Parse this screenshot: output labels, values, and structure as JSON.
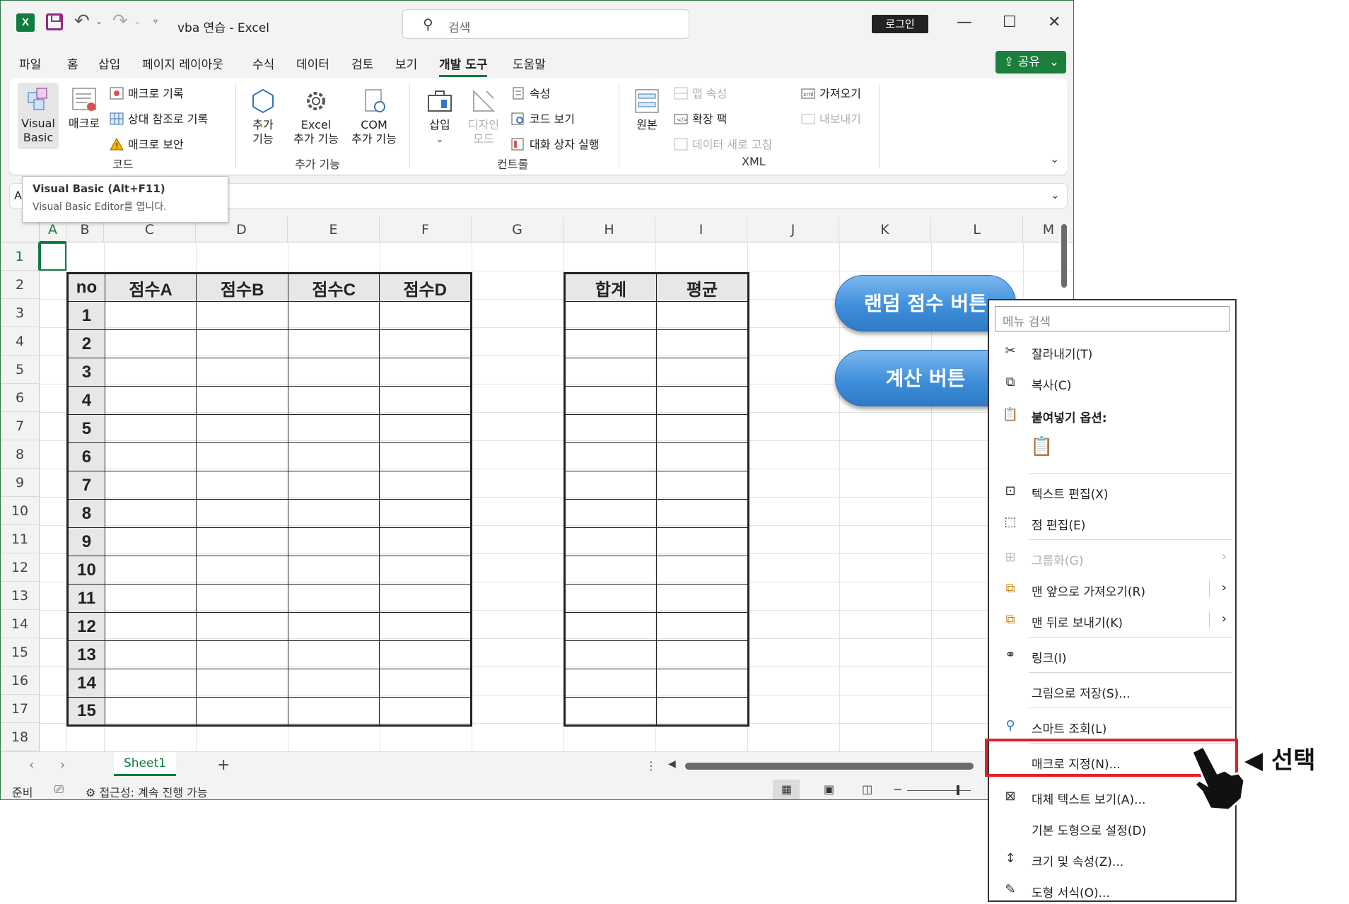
{
  "titlebar": {
    "app_logo": "X",
    "doc_title": "vba 연습  -  Excel",
    "search_placeholder": "검색",
    "login": "로그인"
  },
  "tabs": [
    "파일",
    "홈",
    "삽입",
    "페이지 레이아웃",
    "수식",
    "데이터",
    "검토",
    "보기",
    "개발 도구",
    "도움말"
  ],
  "active_tab": "개발 도구",
  "share": "공유",
  "ribbon": {
    "code": {
      "visual_basic_1": "Visual",
      "visual_basic_2": "Basic",
      "macro": "매크로",
      "record": "매크로 기록",
      "relative": "상대 참조로 기록",
      "security": "매크로 보안",
      "label": "코드"
    },
    "addins": {
      "add_1": "추가",
      "add_2": "기능",
      "excel_1": "Excel",
      "excel_2": "추가 기능",
      "com_1": "COM",
      "com_2": "추가 기능",
      "label": "추가 기능"
    },
    "controls": {
      "insert": "삽입",
      "design_1": "디자인",
      "design_2": "모드",
      "properties": "속성",
      "view_code": "코드 보기",
      "run_dialog": "대화 상자 실행",
      "label": "컨트롤"
    },
    "xml": {
      "source": "원본",
      "map_props": "맵 속성",
      "expansion": "확장 팩",
      "refresh": "데이터 새로 고침",
      "import": "가져오기",
      "export": "내보내기",
      "label": "XML"
    }
  },
  "tooltip": {
    "title": "Visual Basic (Alt+F11)",
    "desc": "Visual Basic Editor를 엽니다."
  },
  "name_box_partial": "A",
  "columns": [
    "A",
    "B",
    "C",
    "D",
    "E",
    "F",
    "G",
    "H",
    "I",
    "J",
    "K",
    "L",
    "M"
  ],
  "rows": [
    "1",
    "2",
    "3",
    "4",
    "5",
    "6",
    "7",
    "8",
    "9",
    "10",
    "11",
    "12",
    "13",
    "14",
    "15",
    "16",
    "17",
    "18"
  ],
  "score_table": {
    "headers": [
      "no",
      "점수A",
      "점수B",
      "점수C",
      "점수D"
    ],
    "numbers": [
      "1",
      "2",
      "3",
      "4",
      "5",
      "6",
      "7",
      "8",
      "9",
      "10",
      "11",
      "12",
      "13",
      "14",
      "15"
    ]
  },
  "sum_table": {
    "headers": [
      "합계",
      "평균"
    ]
  },
  "buttons": {
    "random": "랜덤 점수 버튼",
    "calc": "계산 버튼"
  },
  "sheet": {
    "tab": "Sheet1",
    "add": "+"
  },
  "status": {
    "ready": "준비",
    "accessibility": "접근성: 계속 진행 가능"
  },
  "context_menu": {
    "search_placeholder": "메뉴 검색",
    "cut": "잘라내기(T)",
    "copy": "복사(C)",
    "paste_options": "붙여넣기 옵션:",
    "edit_text": "텍스트 편집(X)",
    "edit_points": "점 편집(E)",
    "group": "그룹화(G)",
    "bring_front": "맨 앞으로 가져오기(R)",
    "send_back": "맨 뒤로 보내기(K)",
    "link": "링크(I)",
    "save_picture": "그림으로 저장(S)...",
    "smart_lookup": "스마트 조회(L)",
    "assign_macro": "매크로 지정(N)...",
    "alt_text": "대체 텍스트 보기(A)...",
    "default_shape": "기본 도형으로 설정(D)",
    "size_props": "크기 및 속성(Z)...",
    "format_shape": "도형 서식(O)..."
  },
  "callout": "◀ 선택",
  "colors": {
    "excel_green": "#107c41",
    "button_blue": "#3f8fdb",
    "highlight_red": "#e3202a"
  }
}
